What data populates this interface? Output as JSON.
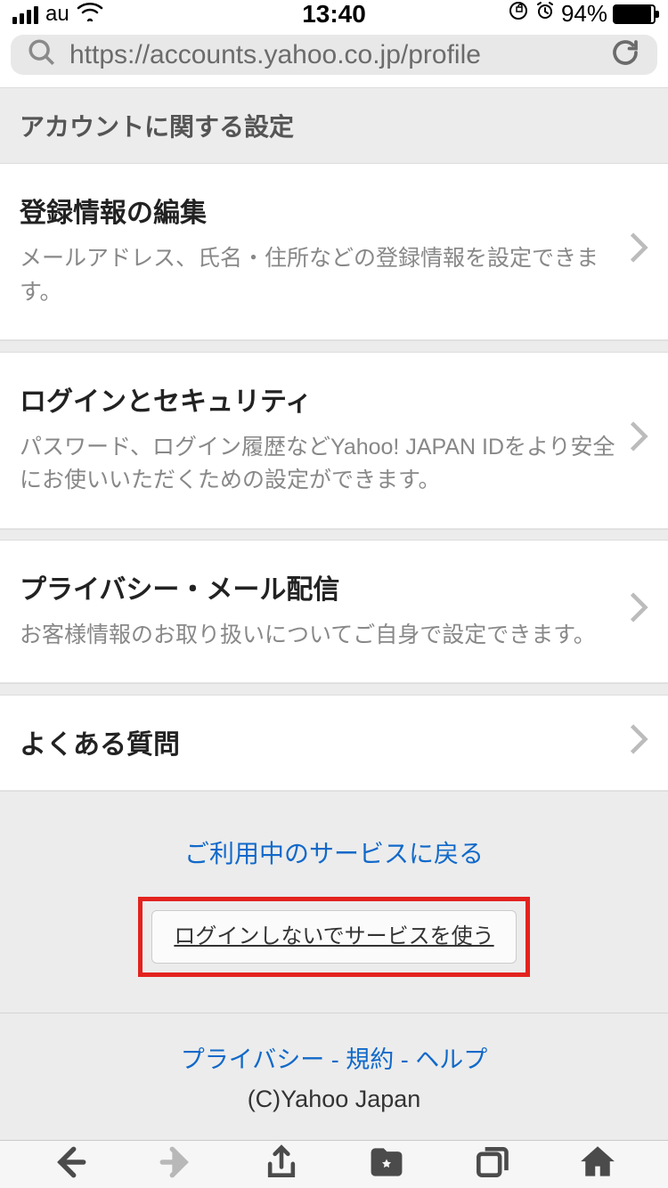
{
  "status": {
    "carrier": "au",
    "time": "13:40",
    "battery_pct": "94%"
  },
  "browser": {
    "url": "https://accounts.yahoo.co.jp/profile"
  },
  "section_header": "アカウントに関する設定",
  "items": [
    {
      "title": "登録情報の編集",
      "desc": "メールアドレス、氏名・住所などの登録情報を設定できます。"
    },
    {
      "title": "ログインとセキュリティ",
      "desc": "パスワード、ログイン履歴などYahoo! JAPAN IDをより安全にお使いいただくための設定ができます。"
    },
    {
      "title": "プライバシー・メール配信",
      "desc": "お客様情報のお取り扱いについてご自身で設定できます。"
    },
    {
      "title": "よくある質問",
      "desc": ""
    }
  ],
  "footer": {
    "return_link": "ご利用中のサービスに戻る",
    "logout_button": "ログインしないでサービスを使う",
    "links": {
      "privacy": "プライバシー",
      "terms": "規約",
      "help": "ヘルプ"
    },
    "separator": " - ",
    "copyright": "(C)Yahoo Japan"
  }
}
